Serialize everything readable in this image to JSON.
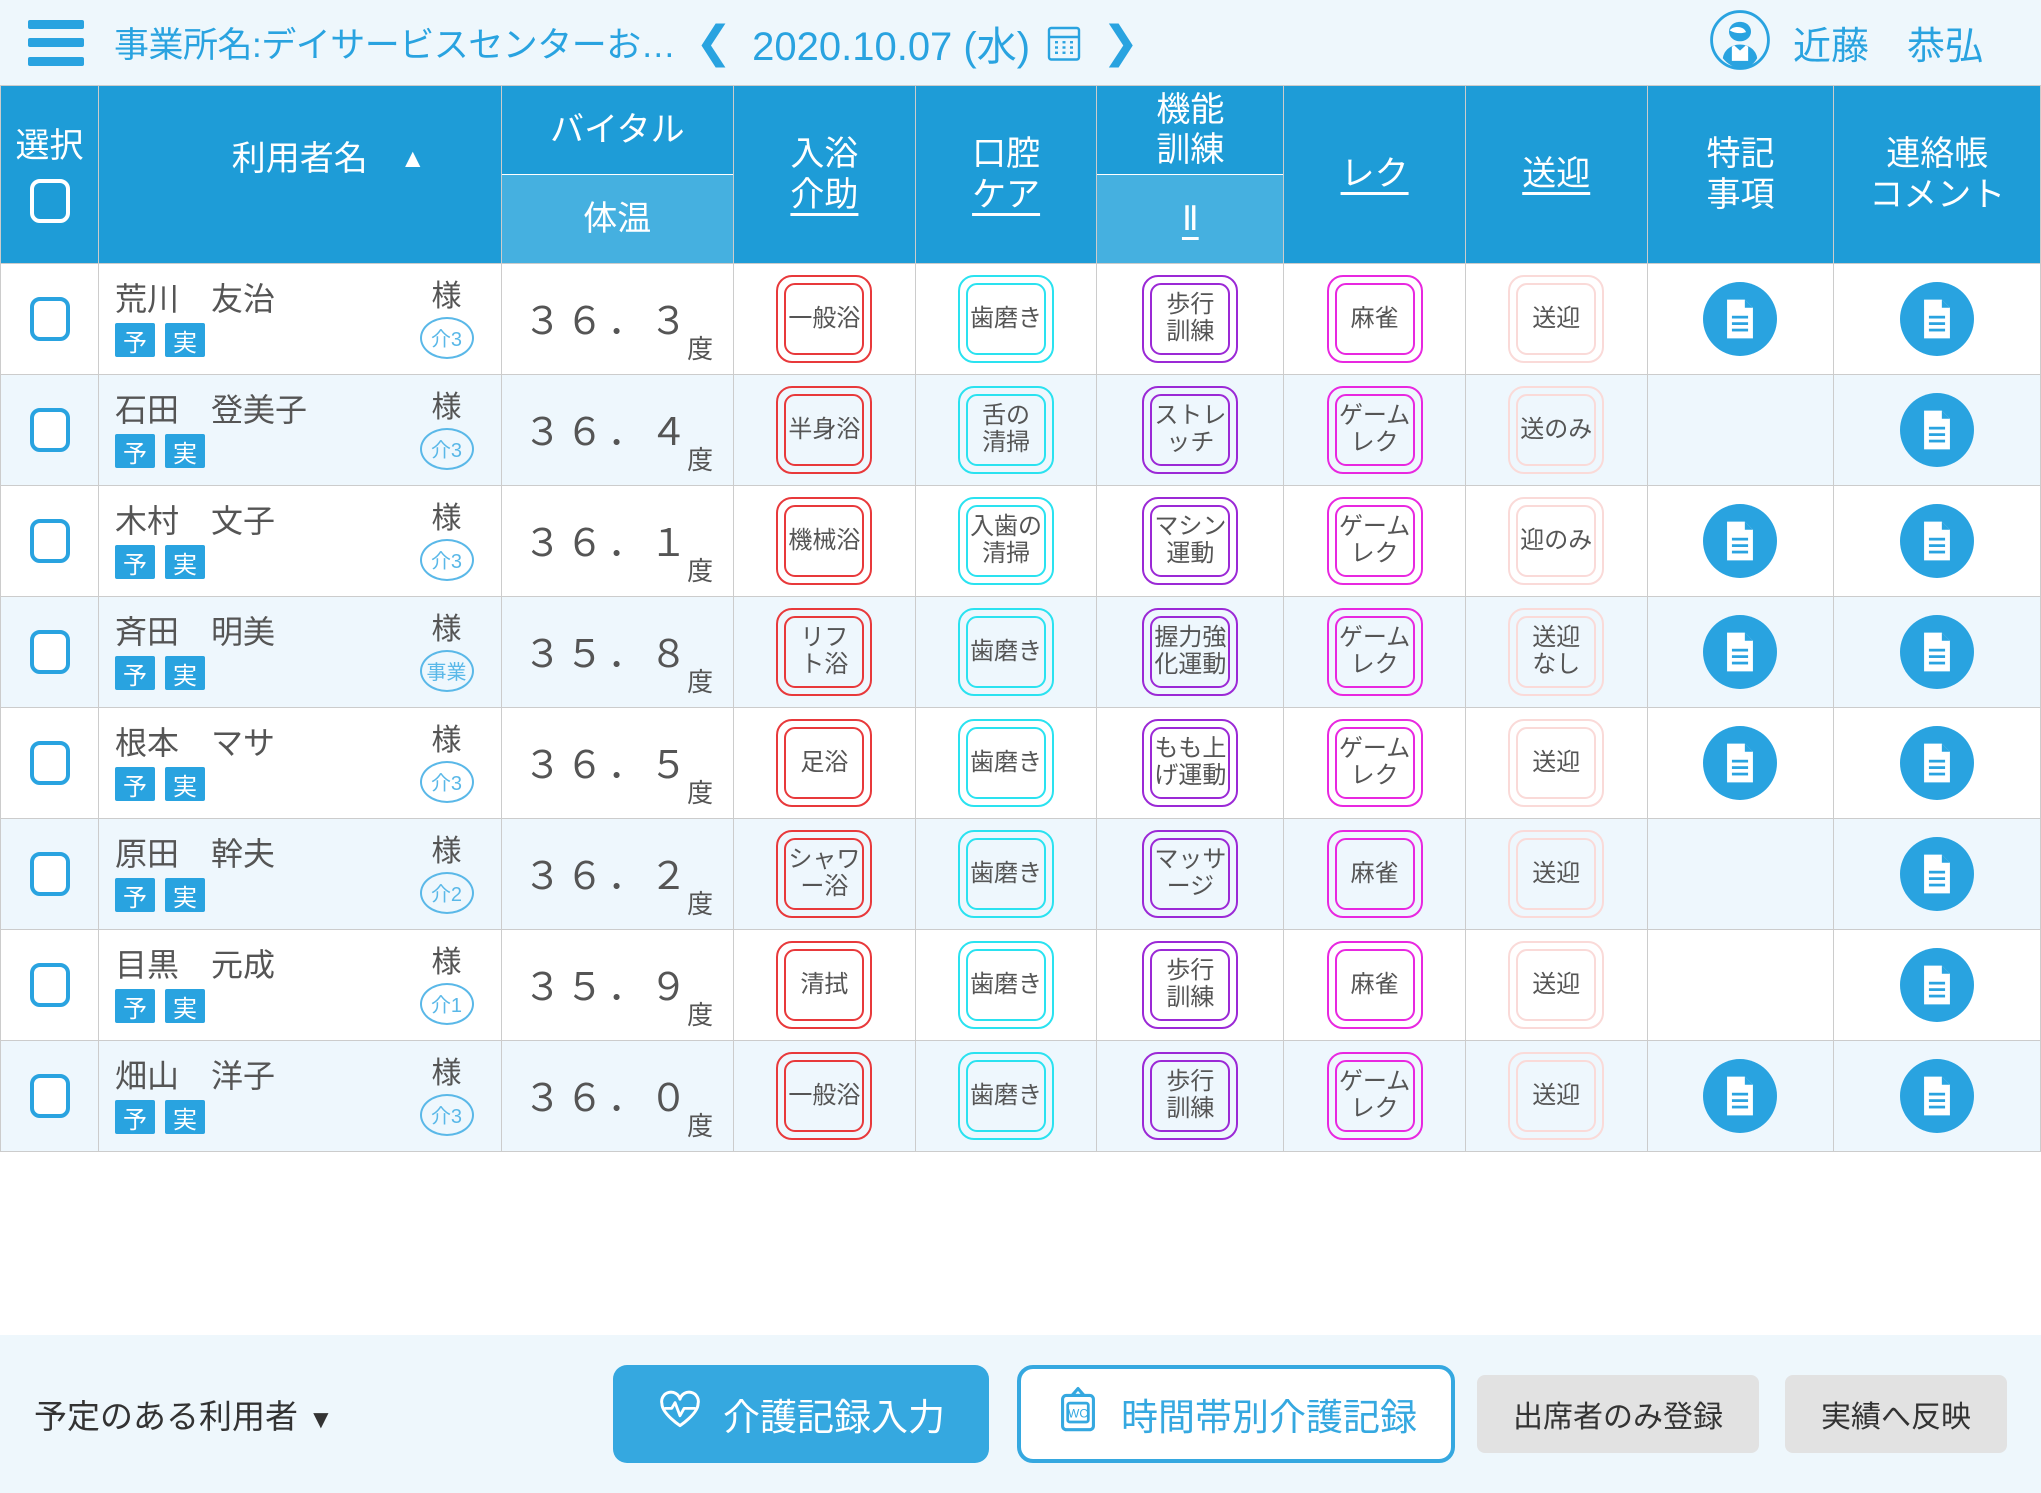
{
  "header": {
    "menu_icon": "hamburger-icon",
    "office_label": "事業所名:デイサービスセンターお…",
    "prev_icon": "chevron-left-icon",
    "next_icon": "chevron-right-icon",
    "date": "2020.10.07 (水)",
    "calendar_icon": "calendar-icon",
    "avatar_icon": "user-avatar-icon",
    "user_name": "近藤　恭弘",
    "accent_color": "#29a3e0"
  },
  "table": {
    "columns": {
      "select": "選択",
      "name": "利用者名",
      "sort_indicator": "▲",
      "vital": "バイタル",
      "vital_sub": "体温",
      "bath": "入浴\n介助",
      "bath_l1": "入浴",
      "bath_l2": "介助",
      "oral_l1": "口腔",
      "oral_l2": "ケア",
      "func_l1": "機能",
      "func_l2": "訓練",
      "func_sub": "Ⅱ",
      "rec": "レク",
      "transport": "送迎",
      "note_l1": "特記",
      "note_l2": "事項",
      "comment_l1": "連絡帳",
      "comment_l2": "コメント"
    },
    "header_checkbox_checked": false,
    "rows": [
      {
        "checked": false,
        "name": "荒川　友治",
        "honorific": "様",
        "tags": [
          "予",
          "実"
        ],
        "care_level": "介3",
        "temp": "３６．３",
        "temp_unit": "度",
        "bath": "一般浴",
        "oral": "歯磨き",
        "func": "歩行\n訓練",
        "rec": "麻雀",
        "transport": "送迎",
        "note_icon": true,
        "comment_icon": true
      },
      {
        "checked": false,
        "name": "石田　登美子",
        "honorific": "様",
        "tags": [
          "予",
          "実"
        ],
        "care_level": "介3",
        "temp": "３６．４",
        "temp_unit": "度",
        "bath": "半身浴",
        "oral": "舌の\n清掃",
        "func": "ストレ\nッチ",
        "rec": "ゲーム\nレク",
        "transport": "送のみ",
        "note_icon": false,
        "comment_icon": true
      },
      {
        "checked": false,
        "name": "木村　文子",
        "honorific": "様",
        "tags": [
          "予",
          "実"
        ],
        "care_level": "介3",
        "temp": "３６．１",
        "temp_unit": "度",
        "bath": "機械浴",
        "oral": "入歯の\n清掃",
        "func": "マシン\n運動",
        "rec": "ゲーム\nレク",
        "transport": "迎のみ",
        "note_icon": true,
        "comment_icon": true
      },
      {
        "checked": false,
        "name": "斉田　明美",
        "honorific": "様",
        "tags": [
          "予",
          "実"
        ],
        "care_level": "事業",
        "temp": "３５．８",
        "temp_unit": "度",
        "bath": "リフ\nト浴",
        "oral": "歯磨き",
        "func": "握力強\n化運動",
        "rec": "ゲーム\nレク",
        "transport": "送迎\nなし",
        "note_icon": true,
        "comment_icon": true
      },
      {
        "checked": false,
        "name": "根本　マサ",
        "honorific": "様",
        "tags": [
          "予",
          "実"
        ],
        "care_level": "介3",
        "temp": "３６．５",
        "temp_unit": "度",
        "bath": "足浴",
        "oral": "歯磨き",
        "func": "もも上\nげ運動",
        "rec": "ゲーム\nレク",
        "transport": "送迎",
        "note_icon": true,
        "comment_icon": true
      },
      {
        "checked": false,
        "name": "原田　幹夫",
        "honorific": "様",
        "tags": [
          "予",
          "実"
        ],
        "care_level": "介2",
        "temp": "３６．２",
        "temp_unit": "度",
        "bath": "シャワ\nー浴",
        "oral": "歯磨き",
        "func": "マッサ\nージ",
        "rec": "麻雀",
        "transport": "送迎",
        "note_icon": false,
        "comment_icon": true
      },
      {
        "checked": false,
        "name": "目黒　元成",
        "honorific": "様",
        "tags": [
          "予",
          "実"
        ],
        "care_level": "介1",
        "temp": "３５．９",
        "temp_unit": "度",
        "bath": "清拭",
        "oral": "歯磨き",
        "func": "歩行\n訓練",
        "rec": "麻雀",
        "transport": "送迎",
        "note_icon": false,
        "comment_icon": true
      },
      {
        "checked": false,
        "name": "畑山　洋子",
        "honorific": "様",
        "tags": [
          "予",
          "実"
        ],
        "care_level": "介3",
        "temp": "３６．０",
        "temp_unit": "度",
        "bath": "一般浴",
        "oral": "歯磨き",
        "func": "歩行\n訓練",
        "rec": "ゲーム\nレク",
        "transport": "送迎",
        "note_icon": true,
        "comment_icon": true
      }
    ]
  },
  "footer": {
    "filter_label": "予定のある利用者",
    "filter_caret": "▼",
    "care_record_icon": "heartbeat-icon",
    "care_record_label": "介護記録入力",
    "time_record_icon": "wc-board-icon",
    "time_record_label": "時間帯別介護記録",
    "register_attendees_label": "出席者のみ登録",
    "reflect_results_label": "実績へ反映"
  }
}
